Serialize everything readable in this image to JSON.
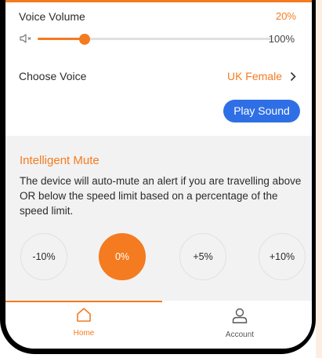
{
  "voice_volume": {
    "label": "Voice Volume",
    "value_text": "20%",
    "max_label": "100%",
    "level": 0.2
  },
  "choose_voice": {
    "label": "Choose Voice",
    "value": "UK Female"
  },
  "play_sound": {
    "label": "Play Sound"
  },
  "intelligent_mute": {
    "title": "Intelligent Mute",
    "description": "The device will auto-mute an alert if you are travelling above OR below the speed limit based on a percentage of the speed limit.",
    "options": [
      "-10%",
      "0%",
      "+5%",
      "+10%"
    ],
    "selected": "0%"
  },
  "tabs": [
    {
      "label": "Home",
      "icon": "home-icon",
      "active": true
    },
    {
      "label": "Account",
      "icon": "account-icon",
      "active": false
    }
  ],
  "colors": {
    "accent": "#f47b20",
    "button": "#2f6fe6",
    "section_bg": "#f2f2f2"
  }
}
